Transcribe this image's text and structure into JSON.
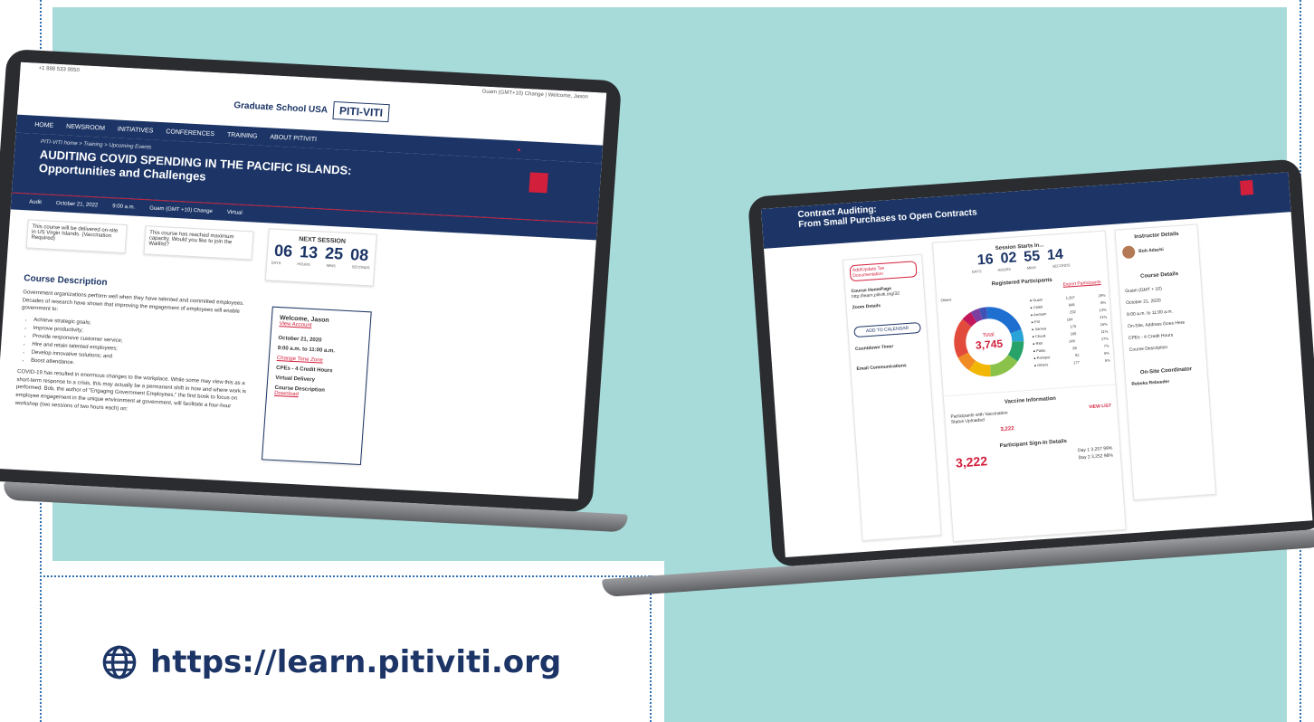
{
  "url_text": "https://learn.pitiviti.org",
  "colors": {
    "navy": "#1c3566",
    "red": "#d21f3c",
    "teal": "#a7dbd9"
  },
  "laptop1": {
    "topbar_left": "+1 888 533 9050",
    "topbar_right": "Guam (GMT+10) Change | Welcome, Jason",
    "logo_org": "Graduate School USA",
    "logo_brand": "PITI-VITI",
    "logo_tagline": "PACIFIC & VIRGIN ISLANDS TRAINING INITIATIVES",
    "nav": [
      "HOME",
      "NEWSROOM",
      "INITIATIVES",
      "CONFERENCES",
      "TRAINING",
      "ABOUT PITIVITI"
    ],
    "breadcrumb": "PITI-VITI home  >  Training  >  Upcoming Events",
    "title_line1": "AUDITING COVID SPENDING IN THE PACIFIC ISLANDS:",
    "title_line2": "Opportunities and Challenges",
    "info": [
      "Audit",
      "October 21, 2022",
      "9:00 a.m.",
      "Guam (GMT +10) Change",
      "Virtual"
    ],
    "notice1": "This course will be delivered on-site in US Virgin Islands. (Vaccination Required)",
    "notice2": "This course has reached maximum capacity. Would you like to join the Waitlist?",
    "next_session_label": "NEXT SESSION",
    "timer": [
      "06",
      "13",
      "25",
      "08"
    ],
    "timer_labels": [
      "DAYS",
      "HOURS",
      "MINS",
      "SECONDS"
    ],
    "section_title": "Course Description",
    "para1": "Government organizations perform well when they have talented and committed employees. Decades of research have shown that improving the engagement of employees will enable government to:",
    "bullets": [
      "Achieve strategic goals;",
      "Improve productivity;",
      "Provide responsive customer service;",
      "Hire and retain talented employees;",
      "Develop innovative solutions; and",
      "Boost attendance."
    ],
    "para2": "COVID-19 has resulted in enormous changes to the workplace. While some may view this as a short-term response to a crisis, this may actually be a permanent shift in how and where work is performed. Bob, the author of \"Engaging Government Employees,\" the first book to focus on employee engagement in the unique environment at government, will facilitate a four-hour workshop (two sessions of two hours each) on:",
    "welcome": "Welcome, Jason",
    "view_account": "View Account",
    "side_items": [
      "October 21, 2020",
      "9:00 a.m. to 11:00 a.m.",
      "CPEs - 4 Credit Hours",
      "Virtual Delivery",
      "Course Description"
    ],
    "change_tz": "Change Time Zone",
    "download": "Download"
  },
  "laptop2": {
    "title_line1": "Contract Auditing:",
    "title_line2": "From Small Purchases to Open Contracts",
    "left_btn": "Add/Update Tax Documentation",
    "course_homepage": "Course HomePage",
    "course_url": "http://learn.pitiviti.org/32",
    "zoom_details": "Zoom Details",
    "add_calendar": "ADD TO CALENDAR",
    "countdown_timer": "Countdown Timer",
    "email_comm": "Email Communications",
    "session_starts": "Session Starts In...",
    "timer": [
      "16",
      "02",
      "55",
      "14"
    ],
    "timer_labels": [
      "DAYS",
      "HOURS",
      "MINS",
      "SECONDS"
    ],
    "registered": "Registered Participants",
    "export": "Export Participants",
    "total_label": "Total",
    "total_value": "3,745",
    "others": "Others",
    "legend": [
      "Guam",
      "CNMI",
      "AmSam",
      "FSI",
      "Samoa",
      "Chuuk",
      "RMI",
      "Palau",
      "Pohnpei",
      "Others"
    ],
    "legend_values": [
      "1,307",
      "848",
      "292",
      "184",
      "175",
      "165",
      "148",
      "98",
      "92",
      "177"
    ],
    "legend_pct": [
      "29%",
      "8%",
      "14%",
      "21%",
      "15%",
      "11%",
      "27%",
      "7%",
      "6%",
      "5%"
    ],
    "vaccine": "Vaccine Information",
    "vaccine_text": "Participants with Vaccination Status Uploaded",
    "vaccine_count": "3,222",
    "view_list": "VIEW LIST",
    "signin": "Participant Sign-In Details",
    "signin_total": "3,222",
    "days": [
      "Day 1",
      "Day 2"
    ],
    "day_values": [
      "3,257",
      "3,252"
    ],
    "day_pct": [
      "99%",
      "98%"
    ],
    "instructor": "Instructor Details",
    "instructor_name": "Bob Adachi",
    "course_details": "Course Details",
    "cd_items": [
      "Guam (GMT + 10)",
      "October 21, 2020",
      "9:00 a.m. to 11:00 a.m.",
      "On-Site, Address Goes Here",
      "CPEs - 4 Credit Hours",
      "Course Description"
    ],
    "coordinator": "On-Site Coordinator",
    "coordinator_name": "Rebeka Rebeeder",
    "donut": [
      29,
      8,
      14,
      21,
      15,
      11,
      27,
      7,
      6,
      5
    ],
    "donut_colors": [
      "#1f6fd1",
      "#2aa3d8",
      "#27a36a",
      "#8bc34a",
      "#f2b705",
      "#f08a24",
      "#e24b3b",
      "#c2185b",
      "#7b3fa0",
      "#3f51b5"
    ]
  }
}
